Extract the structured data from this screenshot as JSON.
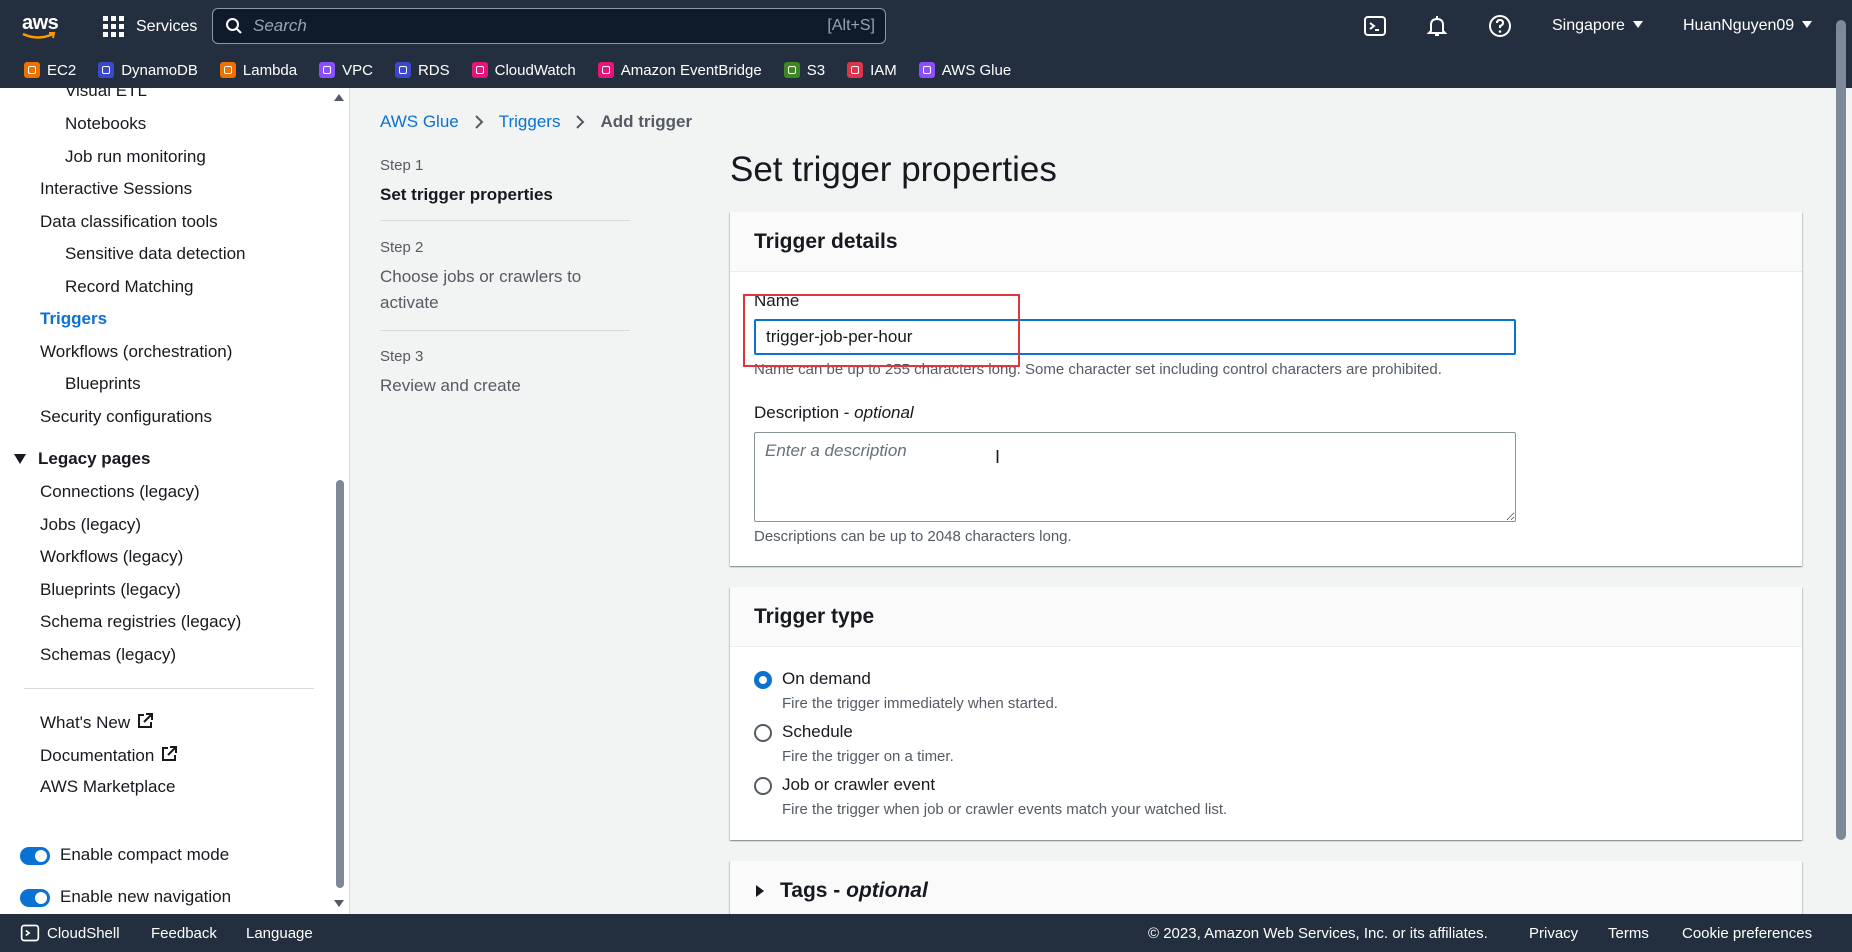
{
  "topnav": {
    "logo": "aws",
    "services_label": "Services",
    "search_placeholder": "Search",
    "search_shortcut": "[Alt+S]",
    "icons": [
      "cloudshell-icon",
      "notifications-icon",
      "help-icon"
    ],
    "region": "Singapore",
    "user": "HuanNguyen09"
  },
  "favorites": [
    {
      "label": "EC2",
      "color": "#ed7100"
    },
    {
      "label": "DynamoDB",
      "color": "#3b48cc"
    },
    {
      "label": "Lambda",
      "color": "#ed7100"
    },
    {
      "label": "VPC",
      "color": "#8c4fff"
    },
    {
      "label": "RDS",
      "color": "#3b48cc"
    },
    {
      "label": "CloudWatch",
      "color": "#e7157b"
    },
    {
      "label": "Amazon EventBridge",
      "color": "#e7157b"
    },
    {
      "label": "S3",
      "color": "#3f8624"
    },
    {
      "label": "IAM",
      "color": "#dd344c"
    },
    {
      "label": "AWS Glue",
      "color": "#8c4fff"
    }
  ],
  "sidebar": {
    "items": [
      "Visual ETL",
      "Notebooks",
      "Job run monitoring",
      "Interactive Sessions",
      "Data classification tools",
      "Sensitive data detection",
      "Record Matching",
      "Triggers",
      "Workflows (orchestration)",
      "Blueprints",
      "Security configurations"
    ],
    "legacy_title": "Legacy pages",
    "legacy_items": [
      "Connections (legacy)",
      "Jobs (legacy)",
      "Workflows (legacy)",
      "Blueprints (legacy)",
      "Schema registries (legacy)",
      "Schemas (legacy)"
    ],
    "links": [
      "What's New",
      "Documentation",
      "AWS Marketplace"
    ],
    "toggles": [
      "Enable compact mode",
      "Enable new navigation"
    ]
  },
  "breadcrumb": {
    "items": [
      "AWS Glue",
      "Triggers"
    ],
    "current": "Add trigger"
  },
  "steps": [
    {
      "label": "Step 1",
      "name": "Set trigger properties"
    },
    {
      "label": "Step 2",
      "name": "Choose jobs or crawlers to activate"
    },
    {
      "label": "Step 3",
      "name": "Review and create"
    }
  ],
  "page_title": "Set trigger properties",
  "trigger_details": {
    "header": "Trigger details",
    "name_label": "Name",
    "name_value": "trigger-job-per-hour",
    "name_hint": "Name can be up to 255 characters long. Some character set including control characters are prohibited.",
    "desc_label": "Description",
    "desc_optional": "optional",
    "desc_placeholder": "Enter a description",
    "desc_hint": "Descriptions can be up to 2048 characters long."
  },
  "trigger_type": {
    "header": "Trigger type",
    "options": [
      {
        "label": "On demand",
        "desc": "Fire the trigger immediately when started.",
        "checked": true
      },
      {
        "label": "Schedule",
        "desc": "Fire the trigger on a timer.",
        "checked": false
      },
      {
        "label": "Job or crawler event",
        "desc": "Fire the trigger when job or crawler events match your watched list.",
        "checked": false
      }
    ]
  },
  "tags": {
    "title": "Tags",
    "optional": "optional"
  },
  "footer": {
    "cloudshell": "CloudShell",
    "feedback": "Feedback",
    "language": "Language",
    "copyright": "© 2023, Amazon Web Services, Inc. or its affiliates.",
    "privacy": "Privacy",
    "terms": "Terms",
    "cookies": "Cookie preferences"
  }
}
